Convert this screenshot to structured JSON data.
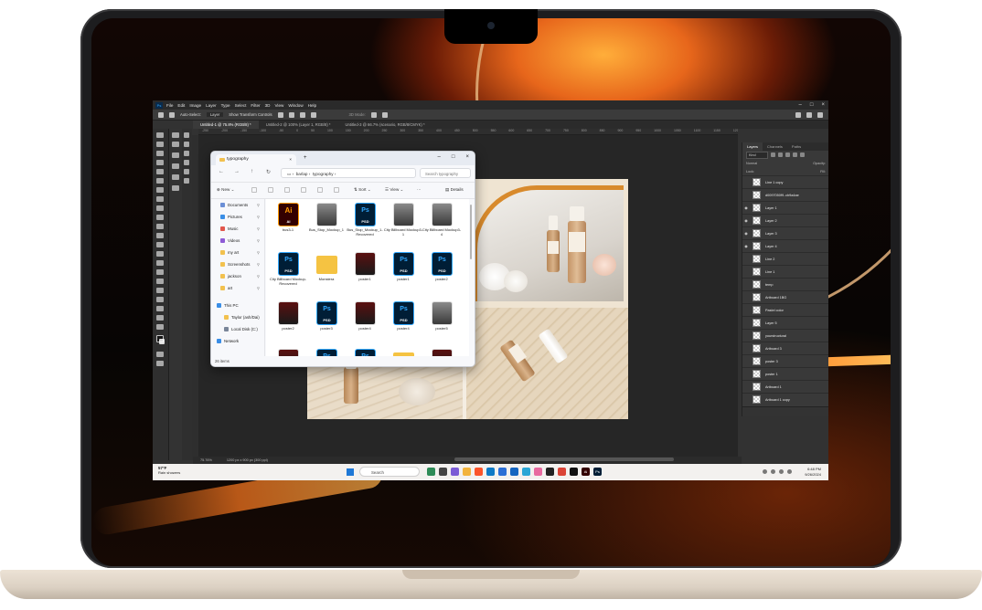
{
  "photoshop": {
    "menu": [
      "File",
      "Edit",
      "Image",
      "Layer",
      "Type",
      "Select",
      "Filter",
      "3D",
      "View",
      "Window",
      "Help"
    ],
    "options": {
      "auto_select": "Auto-Select:",
      "target": "Layer",
      "transform": "Show Transform Controls",
      "mode3d": "3D Mode:"
    },
    "tabs": [
      "Untitled-1 @ 75.8% (RGB/8) *",
      "Untitled-2 @ 100% (Layer 1, RGB/8) *",
      "Untitled-3 @ 66.7% (scenario, RGB/8/CMYK) *"
    ],
    "ruler_ticks": [
      "-250",
      "-200",
      "-150",
      "-100",
      "-50",
      "0",
      "50",
      "100",
      "150",
      "200",
      "250",
      "300",
      "350",
      "400",
      "450",
      "500",
      "550",
      "600",
      "650",
      "700",
      "750",
      "800",
      "850",
      "900",
      "950",
      "1000",
      "1050",
      "1100",
      "1150",
      "1200",
      "1250",
      "1300"
    ],
    "layers_panel": {
      "tabs": [
        "Layers",
        "Channels",
        "Paths"
      ],
      "kind": "Kind",
      "mode": "Normal",
      "opacity": "Opacity:",
      "lock": "Lock:",
      "fill": "Fill:",
      "layers": [
        {
          "name": "Line 1 copy",
          "visible": false
        },
        {
          "name": "d0097050f9..cb9a4ae",
          "visible": false
        },
        {
          "name": "Layer 1",
          "visible": true
        },
        {
          "name": "Layer 2",
          "visible": true
        },
        {
          "name": "Layer 3",
          "visible": true
        },
        {
          "name": "Layer 4",
          "visible": true
        },
        {
          "name": "Line 2",
          "visible": false
        },
        {
          "name": "Line 1",
          "visible": false
        },
        {
          "name": "temp",
          "visible": false
        },
        {
          "name": "Artboard 1BG",
          "visible": false
        },
        {
          "name": "Pastel color",
          "visible": false
        },
        {
          "name": "Layer 5",
          "visible": false
        },
        {
          "name": "yourstructural",
          "visible": false
        },
        {
          "name": "Artboard 3",
          "visible": false
        },
        {
          "name": "poster 3",
          "visible": false
        },
        {
          "name": "poster 1",
          "visible": false
        },
        {
          "name": "Artboard 1",
          "visible": false
        },
        {
          "name": "Artboard 1 copy",
          "visible": false
        },
        {
          "name": "Background",
          "visible": true
        }
      ]
    },
    "status": {
      "zoom": "75.76%",
      "doc_size": "1200 px x 900 px (300 ppi)"
    }
  },
  "explorer": {
    "tab_title": "typography",
    "breadcrumb": [
      "barlap",
      "typography"
    ],
    "search_placeholder": "Search typography",
    "commands": {
      "new": "New",
      "sort": "Sort",
      "view": "View",
      "more": "···",
      "details": "Details"
    },
    "sidebar": [
      {
        "label": "Documents",
        "icon": "documents-icon",
        "color": "#6b8fd6"
      },
      {
        "label": "Pictures",
        "icon": "pictures-icon",
        "color": "#3a8ee6"
      },
      {
        "label": "Music",
        "icon": "music-icon",
        "color": "#e2574c"
      },
      {
        "label": "Videos",
        "icon": "videos-icon",
        "color": "#8e5bd6"
      },
      {
        "label": "my art",
        "icon": "folder-icon",
        "color": "#f2c14e"
      },
      {
        "label": "Screenshots",
        "icon": "folder-icon",
        "color": "#f2c14e"
      },
      {
        "label": "jackson",
        "icon": "folder-icon",
        "color": "#f2c14e"
      },
      {
        "label": "art",
        "icon": "folder-icon",
        "color": "#f2c14e"
      },
      {
        "label": "This PC",
        "icon": "pc-icon",
        "color": "#3a8ee6"
      },
      {
        "label": "Taylor (ash/Dai)",
        "icon": "folder-icon",
        "color": "#f2c14e"
      },
      {
        "label": "Local Disk (C:)",
        "icon": "disk-icon",
        "color": "#7a8699"
      },
      {
        "label": "Network",
        "icon": "network-icon",
        "color": "#3a8ee6"
      }
    ],
    "files": [
      {
        "name": "bus3-1",
        "type": "ai"
      },
      {
        "name": "Bus_Stop_Mockup_1",
        "type": "img"
      },
      {
        "name": "Bus_Stop_Mockup_1-Recovered",
        "type": "ps"
      },
      {
        "name": "City Billboard Mockup3-1",
        "type": "img"
      },
      {
        "name": "City Billboard Mockup3-4",
        "type": "img"
      },
      {
        "name": "City Billboard Mockup-Recovered",
        "type": "ps"
      },
      {
        "name": "Monstera",
        "type": "folder"
      },
      {
        "name": "poster1",
        "type": "dark"
      },
      {
        "name": "poster1",
        "type": "ps"
      },
      {
        "name": "poster2",
        "type": "ps"
      },
      {
        "name": "poster2",
        "type": "dark"
      },
      {
        "name": "poster3",
        "type": "ps"
      },
      {
        "name": "poster4",
        "type": "dark"
      },
      {
        "name": "poster4",
        "type": "ps"
      },
      {
        "name": "poster5",
        "type": "img"
      },
      {
        "name": "",
        "type": "dark"
      },
      {
        "name": "",
        "type": "ps"
      },
      {
        "name": "",
        "type": "ps"
      },
      {
        "name": "",
        "type": "folder"
      },
      {
        "name": "",
        "type": "dark"
      }
    ],
    "status": "26 items"
  },
  "taskbar": {
    "weather_temp": "57°F",
    "weather_desc": "Rain showers",
    "search_label": "Search",
    "time": "6:48 PM",
    "date": "9/26/2024",
    "apps": [
      {
        "name": "landscape-app",
        "color": "#2e8b57",
        "glyph": ""
      },
      {
        "name": "task-view-app",
        "color": "#444444",
        "glyph": ""
      },
      {
        "name": "chat-app",
        "color": "#7b5cd6",
        "glyph": ""
      },
      {
        "name": "explorer-app",
        "color": "#f2b33d",
        "glyph": ""
      },
      {
        "name": "brave-app",
        "color": "#fb542b",
        "glyph": ""
      },
      {
        "name": "edge-app",
        "color": "#0f7ac6",
        "glyph": ""
      },
      {
        "name": "store-app",
        "color": "#2b6fd6",
        "glyph": ""
      },
      {
        "name": "mail-app",
        "color": "#1565c0",
        "glyph": ""
      },
      {
        "name": "photos-app",
        "color": "#2aa6d6",
        "glyph": ""
      },
      {
        "name": "paint-app",
        "color": "#e86aa0",
        "glyph": ""
      },
      {
        "name": "terminal-app",
        "color": "#222222",
        "glyph": ""
      },
      {
        "name": "chrome-app",
        "color": "#db4437",
        "glyph": ""
      },
      {
        "name": "capcut-app",
        "color": "#111111",
        "glyph": ""
      },
      {
        "name": "illustrator-app",
        "color": "#330000",
        "glyph": "Ai"
      },
      {
        "name": "photoshop-app",
        "color": "#001e36",
        "glyph": "Ps"
      }
    ]
  }
}
